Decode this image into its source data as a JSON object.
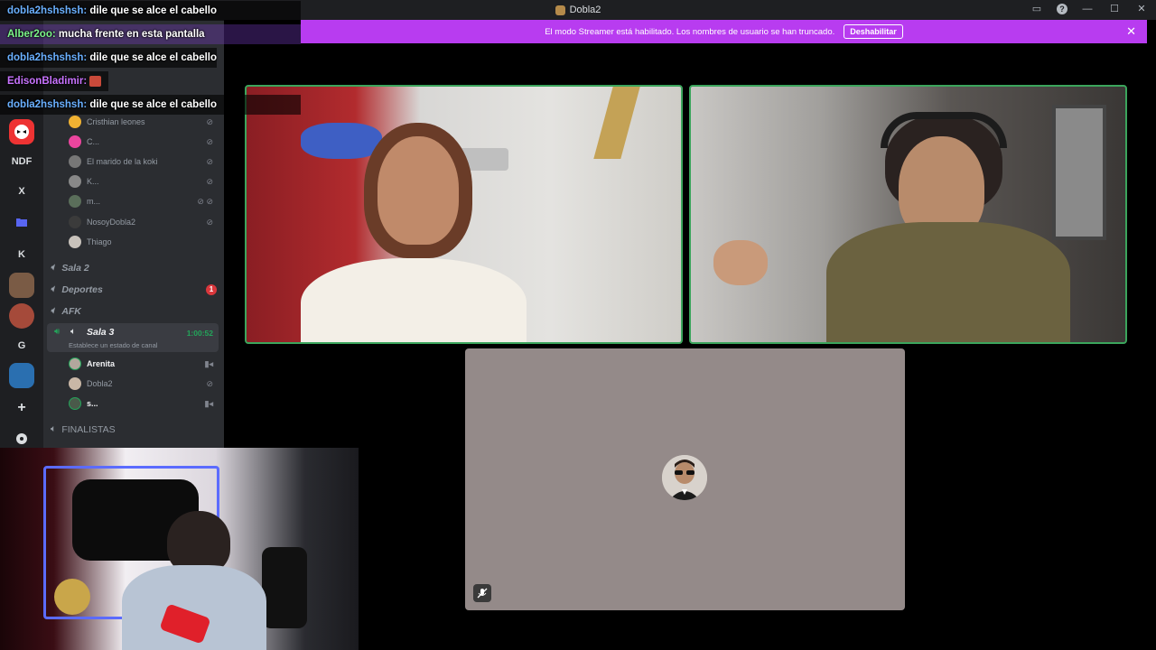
{
  "window": {
    "title": "Dobla2"
  },
  "window_controls": [
    "screen-share-icon",
    "help-icon",
    "minimize-icon",
    "maximize-icon",
    "close-icon"
  ],
  "banner": {
    "text": "El modo Streamer está habilitado. Los nombres de usuario se han truncado.",
    "button_label": "Deshabilitar",
    "close_glyph": "✕",
    "color": "#b83cf0"
  },
  "rail": {
    "servers": [
      "NDF",
      "X",
      "K",
      "G"
    ]
  },
  "channels": {
    "voice_users_top": [
      {
        "name": "Cristhian leones"
      },
      {
        "name": "C..."
      },
      {
        "name": "El marido de la koki"
      },
      {
        "name": "K..."
      },
      {
        "name": "m..."
      },
      {
        "name": "NosoyDobla2"
      },
      {
        "name": "Thiago"
      }
    ],
    "rooms": [
      {
        "name": "Sala 2"
      },
      {
        "name": "Deportes",
        "badge": "1"
      },
      {
        "name": "AFK"
      }
    ],
    "active_room": {
      "name": "Sala 3",
      "time": "1:00:52",
      "status": "Establece un estado de canal"
    },
    "active_users": [
      {
        "name": "Arenita"
      },
      {
        "name": "Dobla2"
      },
      {
        "name": "s..."
      }
    ],
    "finalists": "FINALISTAS"
  },
  "chat": [
    {
      "user": "dobla2hshshsh:",
      "color": "#6ab0ff",
      "message": "dile que se alce el cabello"
    },
    {
      "user": "Alber2oo:",
      "color": "#7cf58a",
      "message": "mucha frente en esta pantalla"
    },
    {
      "user": "dobla2hshshsh:",
      "color": "#6ab0ff",
      "message": "dile que se alce el cabello"
    },
    {
      "user": "EdisonBladimir:",
      "color": "#c873ff",
      "message": ""
    },
    {
      "user": "dobla2hshshsh:",
      "color": "#6ab0ff",
      "message": "dile que se alce el cabello"
    }
  ],
  "colors": {
    "speaking_border": "#3ba55c",
    "timer_green": "#23a55a",
    "badge_red": "#da373c"
  }
}
